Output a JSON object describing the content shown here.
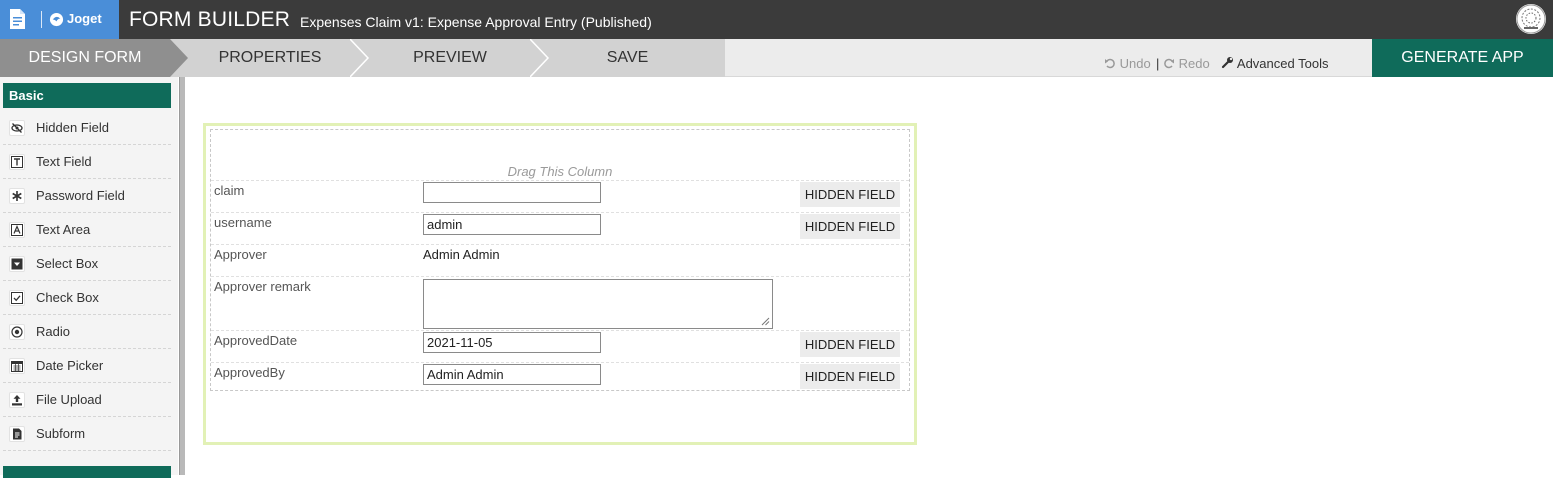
{
  "header": {
    "brand": "Joget",
    "title": "FORM BUILDER",
    "subtitle": "Expenses Claim v1: Expense Approval Entry (Published)"
  },
  "steps": [
    {
      "label": "DESIGN FORM"
    },
    {
      "label": "PROPERTIES"
    },
    {
      "label": "PREVIEW"
    },
    {
      "label": "SAVE"
    }
  ],
  "toolbar": {
    "undo": "Undo",
    "separator": "|",
    "redo": "Redo",
    "advanced": "Advanced Tools",
    "generate": "GENERATE APP"
  },
  "palette": {
    "section": "Basic",
    "items": [
      {
        "label": "Hidden Field",
        "icon": "eye-slash-icon"
      },
      {
        "label": "Text Field",
        "icon": "text-field-icon"
      },
      {
        "label": "Password Field",
        "icon": "asterisk-icon"
      },
      {
        "label": "Text Area",
        "icon": "text-area-icon"
      },
      {
        "label": "Select Box",
        "icon": "select-box-icon"
      },
      {
        "label": "Check Box",
        "icon": "checkbox-icon"
      },
      {
        "label": "Radio",
        "icon": "radio-icon"
      },
      {
        "label": "Date Picker",
        "icon": "calendar-icon"
      },
      {
        "label": "File Upload",
        "icon": "upload-icon"
      },
      {
        "label": "Subform",
        "icon": "subform-icon"
      }
    ]
  },
  "form": {
    "drag_hint": "Drag This Column",
    "hidden_badge": "HIDDEN FIELD",
    "fields": {
      "claim": {
        "label": "claim",
        "value": ""
      },
      "username": {
        "label": "username",
        "value": "admin"
      },
      "approver": {
        "label": "Approver",
        "value": "Admin Admin"
      },
      "remark": {
        "label": "Approver remark",
        "value": ""
      },
      "approved_date": {
        "label": "ApprovedDate",
        "value": "2021-11-05"
      },
      "approved_by": {
        "label": "ApprovedBy",
        "value": "Admin Admin"
      }
    }
  },
  "colors": {
    "header_bg": "#3b3b3b",
    "brand_bg": "#4a8ed8",
    "accent": "#0f6b5a",
    "form_border": "#e2f1b6"
  }
}
